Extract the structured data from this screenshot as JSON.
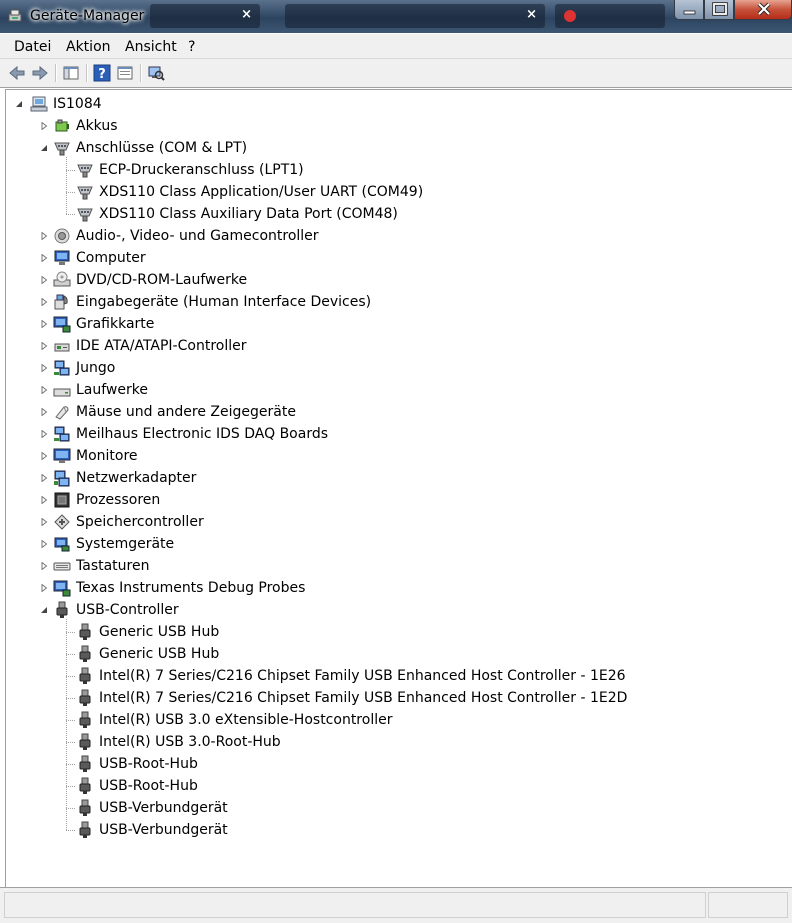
{
  "window": {
    "title": "Geräte-Manager",
    "background_tabs": [
      "×",
      "×"
    ],
    "buttons": {
      "minimize": "minimize",
      "maximize": "maximize",
      "close": "close"
    }
  },
  "menu": [
    "Datei",
    "Aktion",
    "Ansicht",
    "?"
  ],
  "toolbar": {
    "buttons": [
      "back-arrow-icon",
      "forward-arrow-icon",
      "console-tree-icon",
      "help-icon",
      "properties-icon",
      "scan-hardware-icon"
    ]
  },
  "tree": {
    "root": "IS1084",
    "nodes": [
      {
        "label": "Akkus",
        "icon": "battery-icon",
        "level": 1,
        "state": "collapsed"
      },
      {
        "label": "Anschlüsse (COM & LPT)",
        "icon": "port-icon",
        "level": 1,
        "state": "expanded"
      },
      {
        "label": "ECP-Druckeranschluss (LPT1)",
        "icon": "port-icon",
        "level": 2,
        "state": "leaf"
      },
      {
        "label": "XDS110 Class Application/User UART (COM49)",
        "icon": "port-icon",
        "level": 2,
        "state": "leaf"
      },
      {
        "label": "XDS110 Class Auxiliary Data Port (COM48)",
        "icon": "port-icon",
        "level": 2,
        "state": "leaf"
      },
      {
        "label": "Audio-, Video- und Gamecontroller",
        "icon": "speaker-icon",
        "level": 1,
        "state": "collapsed"
      },
      {
        "label": "Computer",
        "icon": "computer-icon",
        "level": 1,
        "state": "collapsed"
      },
      {
        "label": "DVD/CD-ROM-Laufwerke",
        "icon": "dvd-drive-icon",
        "level": 1,
        "state": "collapsed"
      },
      {
        "label": "Eingabegeräte (Human Interface Devices)",
        "icon": "hid-icon",
        "level": 1,
        "state": "collapsed"
      },
      {
        "label": "Grafikkarte",
        "icon": "display-adapter-icon",
        "level": 1,
        "state": "collapsed"
      },
      {
        "label": "IDE ATA/ATAPI-Controller",
        "icon": "ide-controller-icon",
        "level": 1,
        "state": "collapsed"
      },
      {
        "label": "Jungo",
        "icon": "network-device-icon",
        "level": 1,
        "state": "collapsed"
      },
      {
        "label": "Laufwerke",
        "icon": "disk-drive-icon",
        "level": 1,
        "state": "collapsed"
      },
      {
        "label": "Mäuse und andere Zeigegeräte",
        "icon": "mouse-icon",
        "level": 1,
        "state": "collapsed"
      },
      {
        "label": "Meilhaus Electronic IDS DAQ Boards",
        "icon": "network-device-icon",
        "level": 1,
        "state": "collapsed"
      },
      {
        "label": "Monitore",
        "icon": "monitor-icon",
        "level": 1,
        "state": "collapsed"
      },
      {
        "label": "Netzwerkadapter",
        "icon": "network-adapter-icon",
        "level": 1,
        "state": "collapsed"
      },
      {
        "label": "Prozessoren",
        "icon": "processor-icon",
        "level": 1,
        "state": "collapsed"
      },
      {
        "label": "Speichercontroller",
        "icon": "storage-controller-icon",
        "level": 1,
        "state": "collapsed"
      },
      {
        "label": "Systemgeräte",
        "icon": "system-device-icon",
        "level": 1,
        "state": "collapsed"
      },
      {
        "label": "Tastaturen",
        "icon": "keyboard-icon",
        "level": 1,
        "state": "collapsed"
      },
      {
        "label": "Texas Instruments Debug Probes",
        "icon": "display-adapter-icon",
        "level": 1,
        "state": "collapsed"
      },
      {
        "label": "USB-Controller",
        "icon": "usb-plug-icon",
        "level": 1,
        "state": "expanded"
      },
      {
        "label": "Generic USB Hub",
        "icon": "usb-plug-icon",
        "level": 2,
        "state": "leaf"
      },
      {
        "label": "Generic USB Hub",
        "icon": "usb-plug-icon",
        "level": 2,
        "state": "leaf"
      },
      {
        "label": "Intel(R) 7 Series/C216 Chipset Family USB Enhanced Host Controller - 1E26",
        "icon": "usb-plug-icon",
        "level": 2,
        "state": "leaf"
      },
      {
        "label": "Intel(R) 7 Series/C216 Chipset Family USB Enhanced Host Controller - 1E2D",
        "icon": "usb-plug-icon",
        "level": 2,
        "state": "leaf"
      },
      {
        "label": "Intel(R) USB 3.0 eXtensible-Hostcontroller",
        "icon": "usb-plug-icon",
        "level": 2,
        "state": "leaf"
      },
      {
        "label": "Intel(R) USB 3.0-Root-Hub",
        "icon": "usb-plug-icon",
        "level": 2,
        "state": "leaf"
      },
      {
        "label": "USB-Root-Hub",
        "icon": "usb-plug-icon",
        "level": 2,
        "state": "leaf"
      },
      {
        "label": "USB-Root-Hub",
        "icon": "usb-plug-icon",
        "level": 2,
        "state": "leaf"
      },
      {
        "label": "USB-Verbundgerät",
        "icon": "usb-plug-icon",
        "level": 2,
        "state": "leaf"
      },
      {
        "label": "USB-Verbundgerät",
        "icon": "usb-plug-icon",
        "level": 2,
        "state": "leaf"
      }
    ]
  },
  "status_bar": [
    "",
    ""
  ],
  "colors": {
    "titlebar": "#3d5673",
    "close_button": "#c6513a",
    "menubar": "#f0f0f0"
  }
}
